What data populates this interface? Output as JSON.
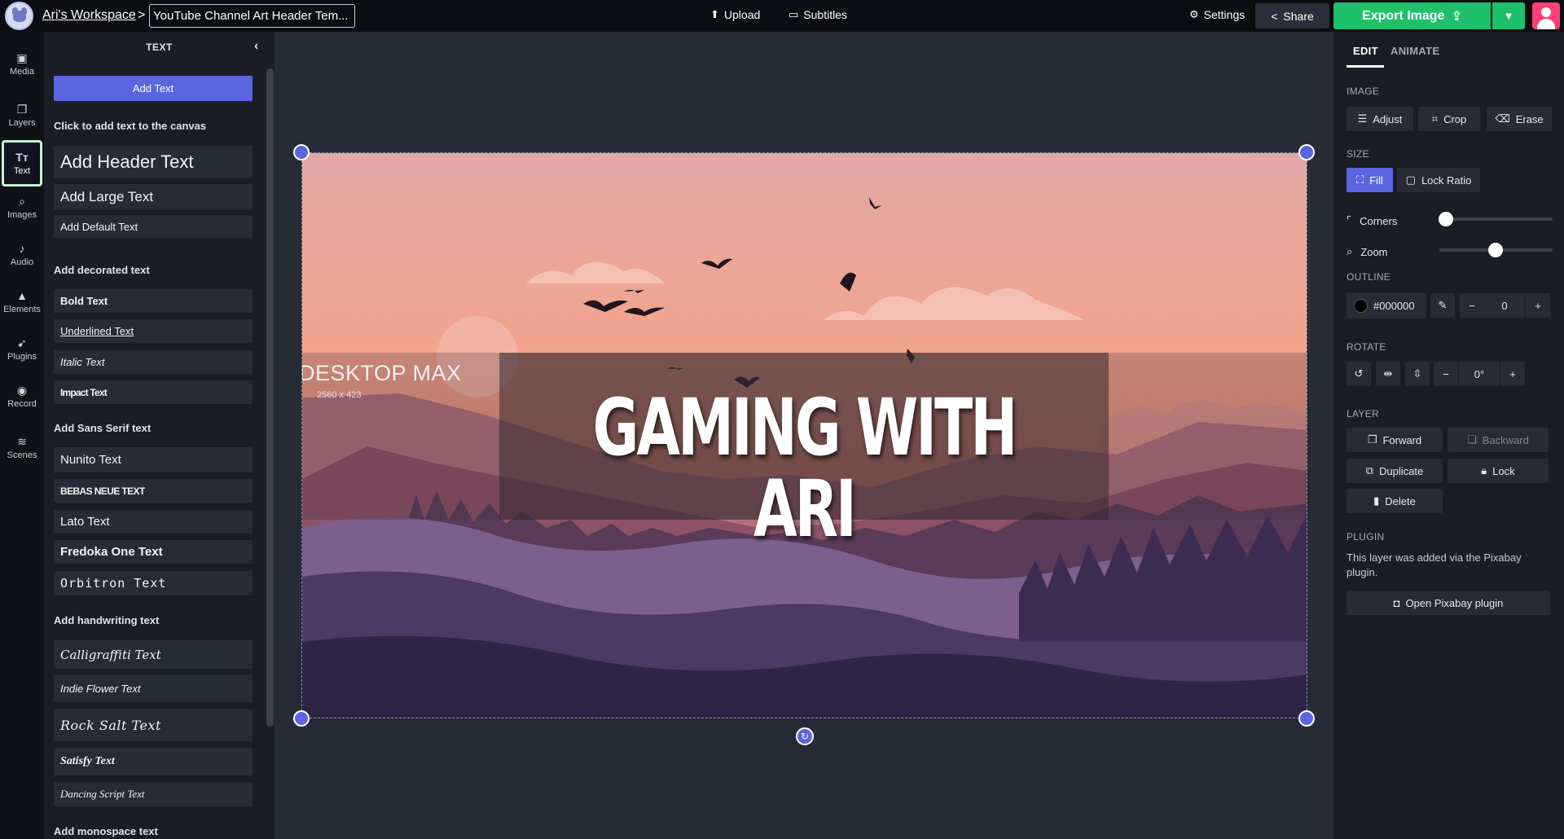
{
  "topbar": {
    "workspace": "Ari's Workspace",
    "separator": ">",
    "doc_title": "YouTube Channel Art Header Tem...",
    "upload": "Upload",
    "subtitles": "Subtitles",
    "settings": "Settings",
    "share": "Share",
    "export": "Export Image"
  },
  "rail": {
    "items": [
      {
        "label": "Media",
        "icon": "image-icon"
      },
      {
        "label": "Layers",
        "icon": "layers-icon"
      },
      {
        "label": "Text",
        "icon": "text-icon",
        "active": true
      },
      {
        "label": "Images",
        "icon": "search-icon"
      },
      {
        "label": "Audio",
        "icon": "music-note-icon"
      },
      {
        "label": "Elements",
        "icon": "shapes-icon"
      },
      {
        "label": "Plugins",
        "icon": "plugin-icon"
      },
      {
        "label": "Record",
        "icon": "record-icon"
      },
      {
        "label": "Scenes",
        "icon": "stack-icon"
      }
    ]
  },
  "panel": {
    "title": "TEXT",
    "add_text": "Add Text",
    "hint": "Click to add text to the canvas",
    "basic": [
      "Add Header Text",
      "Add Large Text",
      "Add Default Text"
    ],
    "decorated_label": "Add decorated text",
    "decorated": [
      "Bold Text",
      "Underlined Text",
      "Italic Text",
      "Impact Text"
    ],
    "sans_label": "Add Sans Serif text",
    "sans": [
      "Nunito Text",
      "BEBAS NEUE TEXT",
      "Lato Text",
      "Fredoka One Text",
      "Orbitron Text"
    ],
    "handwriting_label": "Add handwriting text",
    "handwriting": [
      "Calligraffiti Text",
      "Indie Flower Text",
      "Rock Salt Text",
      "Satisfy Text",
      "Dancing Script Text"
    ],
    "monospace_label": "Add monospace text"
  },
  "canvas": {
    "headline": "GAMING WITH ARI",
    "zone_label": "DESKTOP MAX",
    "zone_dims": "2560 x 423"
  },
  "rpanel": {
    "tabs": [
      "EDIT",
      "ANIMATE"
    ],
    "image_label": "IMAGE",
    "adjust": "Adjust",
    "crop": "Crop",
    "erase": "Erase",
    "size_label": "SIZE",
    "fill": "Fill",
    "lock_ratio": "Lock Ratio",
    "corners": "Corners",
    "zoom": "Zoom",
    "outline_label": "OUTLINE",
    "outline_color": "#000000",
    "outline_width": "0",
    "rotate_label": "ROTATE",
    "rotation": "0°",
    "layer_label": "LAYER",
    "forward": "Forward",
    "backward": "Backward",
    "duplicate": "Duplicate",
    "lock": "Lock",
    "delete": "Delete",
    "plugin_label": "PLUGIN",
    "plugin_note": "This layer was added via the Pixabay plugin.",
    "open_plugin": "Open Pixabay plugin"
  },
  "colors": {
    "accent": "#5b65e0",
    "export": "#1fc06b",
    "active_rail_border": "#bff5d6"
  }
}
